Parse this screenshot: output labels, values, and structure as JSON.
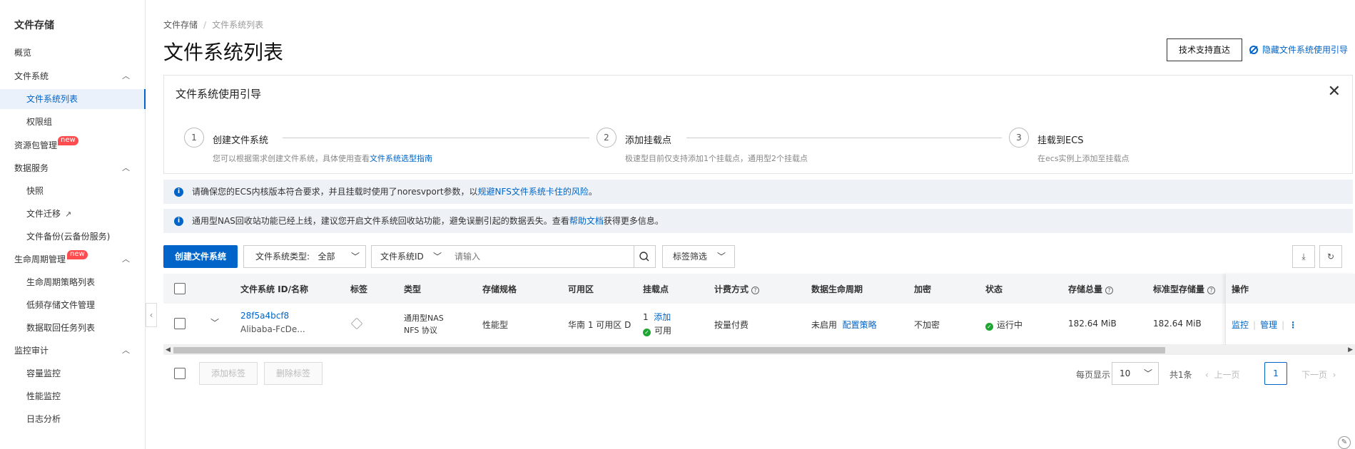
{
  "sidebar": {
    "title": "文件存储",
    "items": [
      {
        "label": "概览"
      },
      {
        "label": "文件系统",
        "chevron": "^"
      },
      {
        "label": "文件系统列表"
      },
      {
        "label": "权限组"
      },
      {
        "label": "资源包管理",
        "badge": "new"
      },
      {
        "label": "数据服务",
        "chevron": "^"
      },
      {
        "label": "快照"
      },
      {
        "label": "文件迁移"
      },
      {
        "label": "文件备份(云备份服务)"
      },
      {
        "label": "生命周期管理",
        "badge": "new",
        "chevron": "^"
      },
      {
        "label": "生命周期策略列表"
      },
      {
        "label": "低频存储文件管理"
      },
      {
        "label": "数据取回任务列表"
      },
      {
        "label": "监控审计",
        "chevron": "^"
      },
      {
        "label": "容量监控"
      },
      {
        "label": "性能监控"
      },
      {
        "label": "日志分析"
      }
    ]
  },
  "breadcrumb": {
    "root": "文件存储",
    "current": "文件系统列表"
  },
  "page_title": "文件系统列表",
  "header": {
    "support_button": "技术支持直达",
    "hide_guide_link": "隐藏文件系统使用引导"
  },
  "guide": {
    "title": "文件系统使用引导",
    "steps": [
      {
        "num": "1",
        "title": "创建文件系统",
        "desc": "您可以根据需求创建文件系统，具体使用查看",
        "link": "文件系统选型指南"
      },
      {
        "num": "2",
        "title": "添加挂载点",
        "desc": "极速型目前仅支持添加1个挂载点，通用型2个挂载点"
      },
      {
        "num": "3",
        "title": "挂载到ECS",
        "desc": "在ecs实例上添加至挂载点"
      }
    ]
  },
  "notices": [
    {
      "text": "请确保您的ECS内核版本符合要求，并且挂载时使用了noresvport参数，以",
      "link": "规避NFS文件系统卡住的风险",
      "suffix": "。"
    },
    {
      "text": "通用型NAS回收站功能已经上线，建议您开启文件系统回收站功能，避免误删引起的数据丢失。查看",
      "link": "帮助文档",
      "suffix": "获得更多信息。"
    }
  ],
  "toolbar": {
    "create_button": "创建文件系统",
    "type_filter_label": "文件系统类型:",
    "type_filter_value": "全部",
    "search_field_select": "文件系统ID",
    "search_placeholder": "请输入",
    "tag_filter": "标签筛选"
  },
  "table": {
    "headers": [
      "文件系统 ID/名称",
      "标签",
      "类型",
      "存储规格",
      "可用区",
      "挂载点",
      "计费方式",
      "数据生命周期",
      "加密",
      "状态",
      "存储总量",
      "标准型存储量",
      "操作"
    ],
    "row": {
      "id": "28f5a4bcf8",
      "name": "Alibaba-FcDe...",
      "type_line1": "通用型NAS",
      "type_line2": "NFS 协议",
      "spec": "性能型",
      "zone": "华南 1 可用区 D",
      "mount_count": "1",
      "mount_add": "添加",
      "mount_status": "可用",
      "billing": "按量付费",
      "lifecycle": "未启用",
      "lifecycle_link": "配置策略",
      "encryption": "不加密",
      "status": "运行中",
      "total": "182.64 MiB",
      "standard": "182.64 MiB",
      "op_monitor": "监控",
      "op_manage": "管理",
      "op_more": "⋮"
    }
  },
  "footer": {
    "add_tag": "添加标签",
    "remove_tag": "删除标签",
    "page_size_label": "每页显示",
    "page_size": "10",
    "total": "共1条",
    "prev": "上一页",
    "page": "1",
    "next": "下一页"
  },
  "colors": {
    "accent": "#0064c8",
    "running": "#1fa533",
    "badge": "#ff4d4f"
  }
}
